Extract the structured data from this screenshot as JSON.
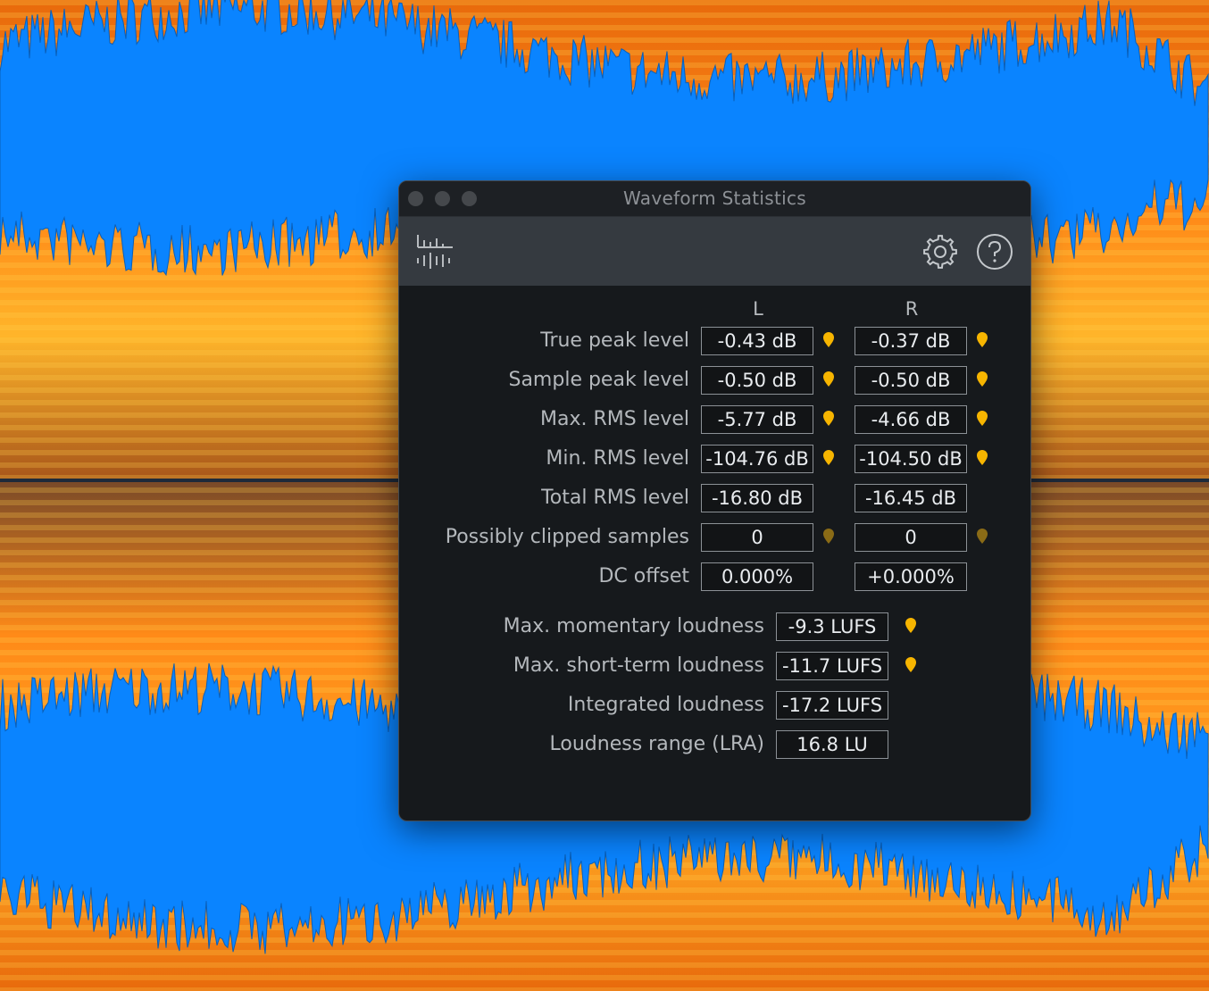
{
  "window": {
    "title": "Waveform Statistics",
    "traffic_lights": [
      "close",
      "minimize",
      "zoom"
    ]
  },
  "toolbar": {
    "module_icon": "waveform-statistics-icon",
    "settings_icon": "gear-icon",
    "help_icon": "help-icon"
  },
  "columns": {
    "left": "L",
    "right": "R"
  },
  "channel_stats": [
    {
      "label": "True peak level",
      "left": "-0.43 dB",
      "right": "-0.37 dB",
      "marker": "active"
    },
    {
      "label": "Sample peak level",
      "left": "-0.50 dB",
      "right": "-0.50 dB",
      "marker": "active"
    },
    {
      "label": "Max. RMS level",
      "left": "-5.77 dB",
      "right": "-4.66 dB",
      "marker": "active"
    },
    {
      "label": "Min. RMS level",
      "left": "-104.76 dB",
      "right": "-104.50 dB",
      "marker": "active"
    },
    {
      "label": "Total RMS level",
      "left": "-16.80 dB",
      "right": "-16.45 dB",
      "marker": "none"
    },
    {
      "label": "Possibly clipped samples",
      "left": "0",
      "right": "0",
      "marker": "dim"
    },
    {
      "label": "DC offset",
      "left": "0.000%",
      "right": "+0.000%",
      "marker": "none"
    }
  ],
  "loudness_stats": [
    {
      "label": "Max. momentary loudness",
      "value": "-9.3 LUFS",
      "marker": "active"
    },
    {
      "label": "Max. short-term loudness",
      "value": "-11.7 LUFS",
      "marker": "active"
    },
    {
      "label": "Integrated loudness",
      "value": "-17.2 LUFS",
      "marker": "none"
    },
    {
      "label": "Loudness range (LRA)",
      "value": "16.8 LU",
      "marker": "none"
    }
  ],
  "colors": {
    "waveform": "#0a84ff",
    "spectrogram_hot": "#ffb020",
    "spectrogram_mid": "#ff7a10",
    "marker_active": "#f7b500",
    "marker_dim": "#8a6b16"
  }
}
